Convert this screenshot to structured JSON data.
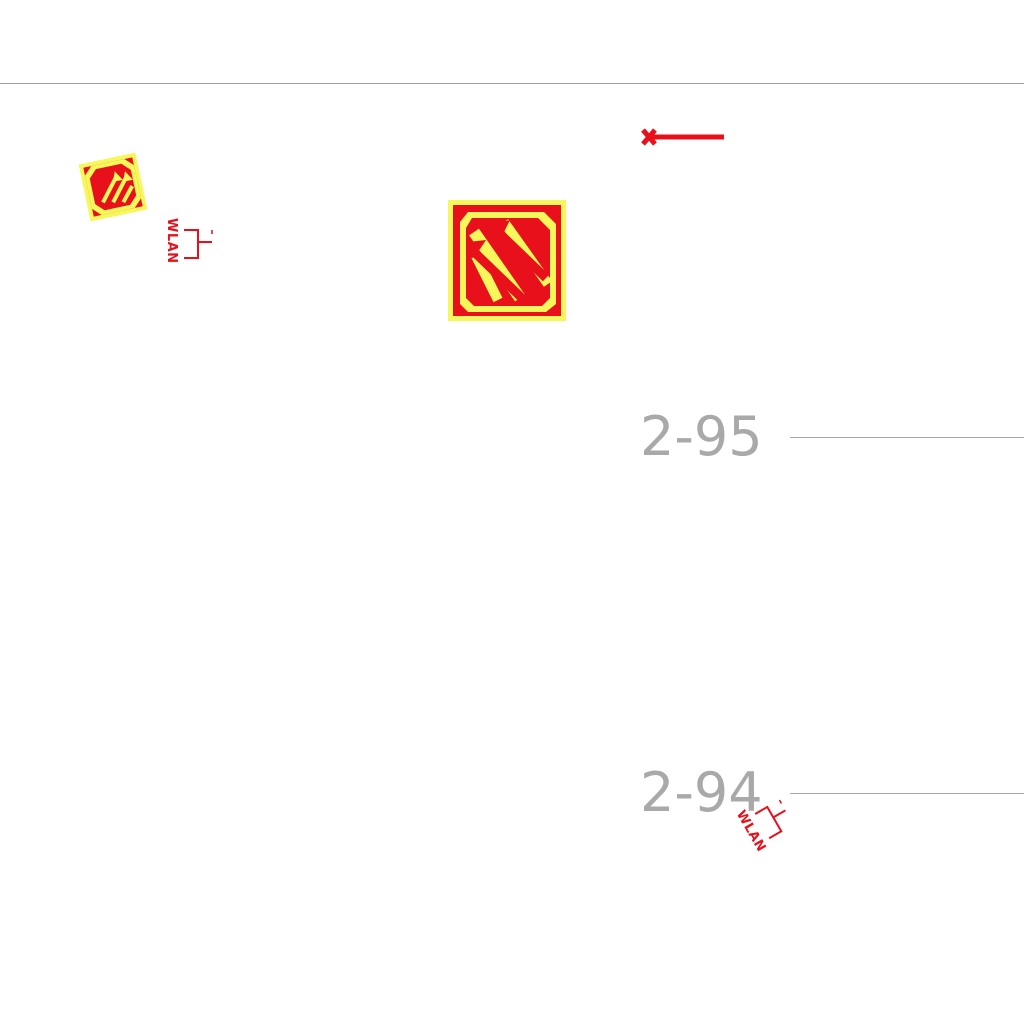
{
  "map": {
    "grid_labels": {
      "row_95": "2-95",
      "row_94": "2-94"
    },
    "wlan_symbols": [
      {
        "text": "WLAN"
      },
      {
        "text": "WLAN"
      }
    ],
    "colors": {
      "symbol_red": "#e8101a",
      "symbol_yellow": "#f6f75a",
      "grid_text": "#a9a9a9",
      "gridline": "#a8a8a8",
      "divider": "#9e9e9e"
    },
    "icons": {
      "small_sign": "evacuation-arrows-icon",
      "large_sign": "evacuation-arrows-icon",
      "wlan": "wlan-access-point-icon",
      "marker": "red-line-marker-icon"
    }
  }
}
